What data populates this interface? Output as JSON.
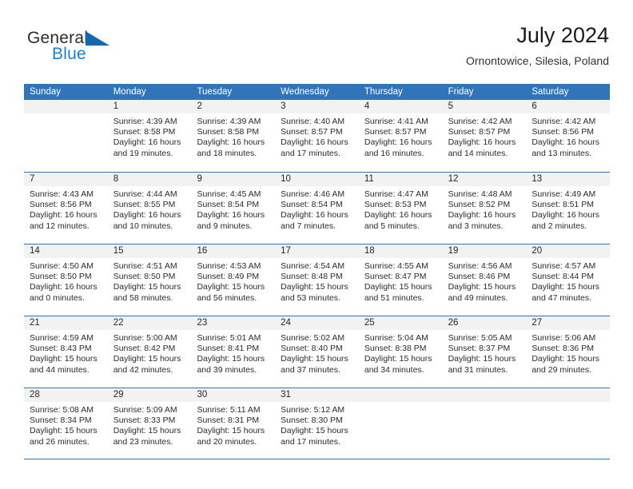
{
  "brand": {
    "word_one": "General",
    "word_two": "Blue",
    "flag_icon": "triangle-flag-icon"
  },
  "header": {
    "title": "July 2024",
    "subtitle": "Ornontowice, Silesia, Poland"
  },
  "colors": {
    "header_blue": "#3274b8",
    "brand_blue": "#1f7ec4",
    "daynum_band": "#f2f2f2",
    "text": "#2b2b2b"
  },
  "calendar": {
    "weekdays": [
      "Sunday",
      "Monday",
      "Tuesday",
      "Wednesday",
      "Thursday",
      "Friday",
      "Saturday"
    ],
    "weeks": [
      [
        {
          "day": "",
          "lines": []
        },
        {
          "day": "1",
          "lines": [
            "Sunrise: 4:39 AM",
            "Sunset: 8:58 PM",
            "Daylight: 16 hours",
            "and 19 minutes."
          ]
        },
        {
          "day": "2",
          "lines": [
            "Sunrise: 4:39 AM",
            "Sunset: 8:58 PM",
            "Daylight: 16 hours",
            "and 18 minutes."
          ]
        },
        {
          "day": "3",
          "lines": [
            "Sunrise: 4:40 AM",
            "Sunset: 8:57 PM",
            "Daylight: 16 hours",
            "and 17 minutes."
          ]
        },
        {
          "day": "4",
          "lines": [
            "Sunrise: 4:41 AM",
            "Sunset: 8:57 PM",
            "Daylight: 16 hours",
            "and 16 minutes."
          ]
        },
        {
          "day": "5",
          "lines": [
            "Sunrise: 4:42 AM",
            "Sunset: 8:57 PM",
            "Daylight: 16 hours",
            "and 14 minutes."
          ]
        },
        {
          "day": "6",
          "lines": [
            "Sunrise: 4:42 AM",
            "Sunset: 8:56 PM",
            "Daylight: 16 hours",
            "and 13 minutes."
          ]
        }
      ],
      [
        {
          "day": "7",
          "lines": [
            "Sunrise: 4:43 AM",
            "Sunset: 8:56 PM",
            "Daylight: 16 hours",
            "and 12 minutes."
          ]
        },
        {
          "day": "8",
          "lines": [
            "Sunrise: 4:44 AM",
            "Sunset: 8:55 PM",
            "Daylight: 16 hours",
            "and 10 minutes."
          ]
        },
        {
          "day": "9",
          "lines": [
            "Sunrise: 4:45 AM",
            "Sunset: 8:54 PM",
            "Daylight: 16 hours",
            "and 9 minutes."
          ]
        },
        {
          "day": "10",
          "lines": [
            "Sunrise: 4:46 AM",
            "Sunset: 8:54 PM",
            "Daylight: 16 hours",
            "and 7 minutes."
          ]
        },
        {
          "day": "11",
          "lines": [
            "Sunrise: 4:47 AM",
            "Sunset: 8:53 PM",
            "Daylight: 16 hours",
            "and 5 minutes."
          ]
        },
        {
          "day": "12",
          "lines": [
            "Sunrise: 4:48 AM",
            "Sunset: 8:52 PM",
            "Daylight: 16 hours",
            "and 3 minutes."
          ]
        },
        {
          "day": "13",
          "lines": [
            "Sunrise: 4:49 AM",
            "Sunset: 8:51 PM",
            "Daylight: 16 hours",
            "and 2 minutes."
          ]
        }
      ],
      [
        {
          "day": "14",
          "lines": [
            "Sunrise: 4:50 AM",
            "Sunset: 8:50 PM",
            "Daylight: 16 hours",
            "and 0 minutes."
          ]
        },
        {
          "day": "15",
          "lines": [
            "Sunrise: 4:51 AM",
            "Sunset: 8:50 PM",
            "Daylight: 15 hours",
            "and 58 minutes."
          ]
        },
        {
          "day": "16",
          "lines": [
            "Sunrise: 4:53 AM",
            "Sunset: 8:49 PM",
            "Daylight: 15 hours",
            "and 56 minutes."
          ]
        },
        {
          "day": "17",
          "lines": [
            "Sunrise: 4:54 AM",
            "Sunset: 8:48 PM",
            "Daylight: 15 hours",
            "and 53 minutes."
          ]
        },
        {
          "day": "18",
          "lines": [
            "Sunrise: 4:55 AM",
            "Sunset: 8:47 PM",
            "Daylight: 15 hours",
            "and 51 minutes."
          ]
        },
        {
          "day": "19",
          "lines": [
            "Sunrise: 4:56 AM",
            "Sunset: 8:46 PM",
            "Daylight: 15 hours",
            "and 49 minutes."
          ]
        },
        {
          "day": "20",
          "lines": [
            "Sunrise: 4:57 AM",
            "Sunset: 8:44 PM",
            "Daylight: 15 hours",
            "and 47 minutes."
          ]
        }
      ],
      [
        {
          "day": "21",
          "lines": [
            "Sunrise: 4:59 AM",
            "Sunset: 8:43 PM",
            "Daylight: 15 hours",
            "and 44 minutes."
          ]
        },
        {
          "day": "22",
          "lines": [
            "Sunrise: 5:00 AM",
            "Sunset: 8:42 PM",
            "Daylight: 15 hours",
            "and 42 minutes."
          ]
        },
        {
          "day": "23",
          "lines": [
            "Sunrise: 5:01 AM",
            "Sunset: 8:41 PM",
            "Daylight: 15 hours",
            "and 39 minutes."
          ]
        },
        {
          "day": "24",
          "lines": [
            "Sunrise: 5:02 AM",
            "Sunset: 8:40 PM",
            "Daylight: 15 hours",
            "and 37 minutes."
          ]
        },
        {
          "day": "25",
          "lines": [
            "Sunrise: 5:04 AM",
            "Sunset: 8:38 PM",
            "Daylight: 15 hours",
            "and 34 minutes."
          ]
        },
        {
          "day": "26",
          "lines": [
            "Sunrise: 5:05 AM",
            "Sunset: 8:37 PM",
            "Daylight: 15 hours",
            "and 31 minutes."
          ]
        },
        {
          "day": "27",
          "lines": [
            "Sunrise: 5:06 AM",
            "Sunset: 8:36 PM",
            "Daylight: 15 hours",
            "and 29 minutes."
          ]
        }
      ],
      [
        {
          "day": "28",
          "lines": [
            "Sunrise: 5:08 AM",
            "Sunset: 8:34 PM",
            "Daylight: 15 hours",
            "and 26 minutes."
          ]
        },
        {
          "day": "29",
          "lines": [
            "Sunrise: 5:09 AM",
            "Sunset: 8:33 PM",
            "Daylight: 15 hours",
            "and 23 minutes."
          ]
        },
        {
          "day": "30",
          "lines": [
            "Sunrise: 5:11 AM",
            "Sunset: 8:31 PM",
            "Daylight: 15 hours",
            "and 20 minutes."
          ]
        },
        {
          "day": "31",
          "lines": [
            "Sunrise: 5:12 AM",
            "Sunset: 8:30 PM",
            "Daylight: 15 hours",
            "and 17 minutes."
          ]
        },
        {
          "day": "",
          "lines": []
        },
        {
          "day": "",
          "lines": []
        },
        {
          "day": "",
          "lines": []
        }
      ]
    ]
  }
}
